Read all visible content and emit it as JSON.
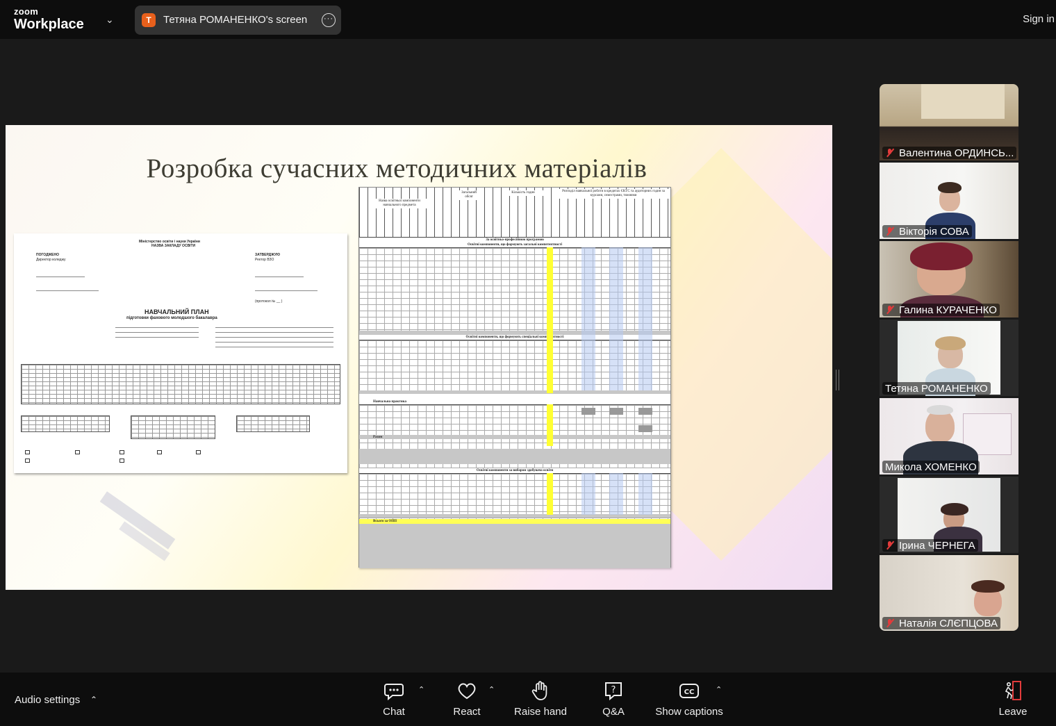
{
  "app": {
    "logo_line1": "zoom",
    "logo_line2": "Workplace",
    "share_initial": "T",
    "share_label": "Тетяна РОМАНЕНКО's screen",
    "sign_in": "Sign in"
  },
  "slide": {
    "title": "Розробка сучасних методичних матеріалів",
    "doc": {
      "ministry": "Міністерство освіти і науки України",
      "institution": "НАЗВА ЗАКЛАДУ ОСВІТИ",
      "agreed": "ПОГОДЖЕНО",
      "director": "Директор коледжу",
      "approve": "ЗАТВЕРДЖУЮ",
      "rector": "Ректор ВЗО",
      "plan_title": "НАВЧАЛЬНИЙ ПЛАН",
      "plan_subtitle": "підготовки фахового молодшого бакалавра",
      "protocol": "(протокол № __ )"
    },
    "sheet": {
      "col_name": "Назва освітньої компоненти навчального предмета",
      "col_credits": "Загальний обсяг",
      "col_hours": "Кількість годин",
      "col_distribution": "Розподіл навчальної роботи в кредитах ЄКТС та аудиторних годин за курсами, семестрами, тижнями",
      "section_program": "За освітньо-професійною програмою",
      "section_general": "Освітні компоненти, що формують загальні компетентності",
      "section_special": "Освітні компоненти, що формують спеціальні компетентності",
      "section_practice": "Навчальна практика",
      "section_elective": "Освітні компоненти за вибором здобувача освіти",
      "total_opp": "Всього за ОПП",
      "total": "Разом"
    }
  },
  "participants": [
    {
      "name": "Валентина ОРДИНСЬ...",
      "muted": true
    },
    {
      "name": "Вікторія СОВА",
      "muted": true
    },
    {
      "name": "Галина КУРАЧЕНКО",
      "muted": true
    },
    {
      "name": "Тетяна РОМАНЕНКО",
      "muted": false
    },
    {
      "name": "Микола ХОМЕНКО",
      "muted": false
    },
    {
      "name": "Ірина ЧЕРНЕГА",
      "muted": true
    },
    {
      "name": "Наталія СЛЄПЦОВА",
      "muted": true
    }
  ],
  "toolbar": {
    "audio_settings": "Audio settings",
    "chat": "Chat",
    "react": "React",
    "raise_hand": "Raise hand",
    "qa": "Q&A",
    "show_captions": "Show captions",
    "leave": "Leave"
  },
  "colors": {
    "active_speaker": "#2ecc71",
    "muted_mic": "#e23b3b",
    "leave_accent": "#e23b3b"
  }
}
